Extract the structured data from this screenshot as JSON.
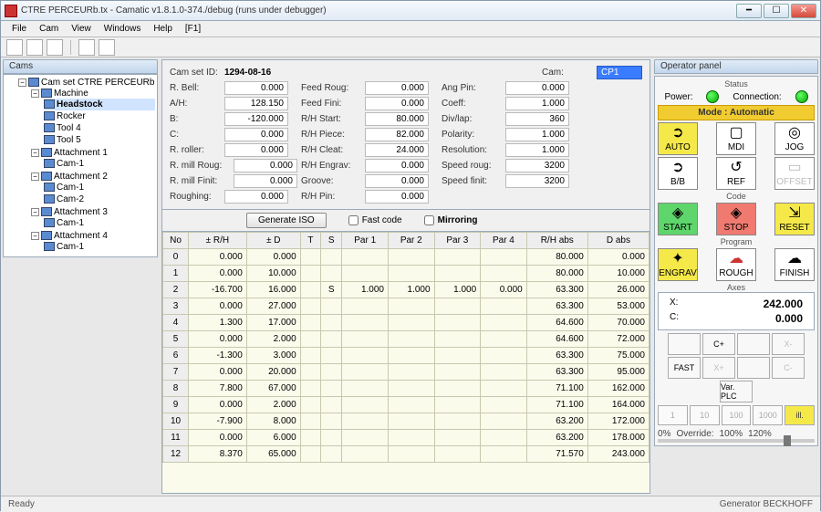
{
  "window": {
    "title": "CTRE PERCEURb.tx - Camatic v1.8.1.0-374./debug (runs under debugger)",
    "ghost1": "",
    "ghost2": "",
    "ghost3": ""
  },
  "menu": {
    "file": "File",
    "cam": "Cam",
    "view": "View",
    "windows": "Windows",
    "help": "Help",
    "f1": "[F1]"
  },
  "left_header": "Cams",
  "tree": {
    "root": "Cam set CTRE PERCEURb",
    "machine": "Machine",
    "headstock": "Headstock",
    "rocker": "Rocker",
    "tool4": "Tool 4",
    "tool5": "Tool 5",
    "att1": "Attachment 1",
    "a1c1": "Cam-1",
    "att2": "Attachment 2",
    "a2c1": "Cam-1",
    "a2c2": "Cam-2",
    "att3": "Attachment 3",
    "a3c1": "Cam-1",
    "att4": "Attachment 4",
    "a4c1": "Cam-1"
  },
  "form": {
    "camset_l": "Cam set ID:",
    "camset_v": "1294-08-16",
    "cam_l": "Cam:",
    "cam_v": "CP1",
    "rbell_l": "R. Bell:",
    "rbell_v": "0.000",
    "feedroug_l": "Feed Roug:",
    "feedroug_v": "0.000",
    "angpin_l": "Ang Pin:",
    "angpin_v": "0.000",
    "ah_l": "A/H:",
    "ah_v": "128.150",
    "feedfini_l": "Feed Fini:",
    "feedfini_v": "0.000",
    "coeff_l": "Coeff:",
    "coeff_v": "1.000",
    "b_l": "B:",
    "b_v": "-120.000",
    "rhstart_l": "R/H Start:",
    "rhstart_v": "80.000",
    "divlap_l": "Div/lap:",
    "divlap_v": "360",
    "c_l": "C:",
    "c_v": "0.000",
    "rhpiece_l": "R/H Piece:",
    "rhpiece_v": "82.000",
    "polarity_l": "Polarity:",
    "polarity_v": "1.000",
    "rroller_l": "R. roller:",
    "rroller_v": "0.000",
    "rhcleat_l": "R/H Cleat:",
    "rhcleat_v": "24.000",
    "resolution_l": "Resolution:",
    "resolution_v": "1.000",
    "rmillroug_l": "R. mill Roug:",
    "rmillroug_v": "0.000",
    "rhengrav_l": "R/H Engrav:",
    "rhengrav_v": "0.000",
    "speedroug_l": "Speed roug:",
    "speedroug_v": "3200",
    "rmillfinit_l": "R. mill Finit:",
    "rmillfinit_v": "0.000",
    "groove_l": "Groove:",
    "groove_v": "0.000",
    "speedfinit_l": "Speed finit:",
    "speedfinit_v": "3200",
    "roughing_l": "Roughing:",
    "roughing_v": "0.000",
    "rhpin_l": "R/H Pin:",
    "rhpin_v": "0.000"
  },
  "gen": {
    "btn": "Generate ISO",
    "fast": "Fast code",
    "mirror": "Mirroring"
  },
  "th": {
    "no": "No",
    "zrh": "± R/H",
    "zd": "± D",
    "t": "T",
    "s": "S",
    "p1": "Par 1",
    "p2": "Par 2",
    "p3": "Par 3",
    "p4": "Par 4",
    "rhabs": "R/H abs",
    "dabs": "D abs"
  },
  "rows": [
    {
      "no": "0",
      "zrh": "0.000",
      "zd": "0.000",
      "t": "",
      "s": "",
      "p1": "",
      "p2": "",
      "p3": "",
      "p4": "",
      "rhabs": "80.000",
      "dabs": "0.000"
    },
    {
      "no": "1",
      "zrh": "0.000",
      "zd": "10.000",
      "t": "",
      "s": "",
      "p1": "",
      "p2": "",
      "p3": "",
      "p4": "",
      "rhabs": "80.000",
      "dabs": "10.000"
    },
    {
      "no": "2",
      "zrh": "-16.700",
      "zd": "16.000",
      "t": "",
      "s": "S",
      "p1": "1.000",
      "p2": "1.000",
      "p3": "1.000",
      "p4": "0.000",
      "rhabs": "63.300",
      "dabs": "26.000"
    },
    {
      "no": "3",
      "zrh": "0.000",
      "zd": "27.000",
      "t": "",
      "s": "",
      "p1": "",
      "p2": "",
      "p3": "",
      "p4": "",
      "rhabs": "63.300",
      "dabs": "53.000"
    },
    {
      "no": "4",
      "zrh": "1.300",
      "zd": "17.000",
      "t": "",
      "s": "",
      "p1": "",
      "p2": "",
      "p3": "",
      "p4": "",
      "rhabs": "64.600",
      "dabs": "70.000"
    },
    {
      "no": "5",
      "zrh": "0.000",
      "zd": "2.000",
      "t": "",
      "s": "",
      "p1": "",
      "p2": "",
      "p3": "",
      "p4": "",
      "rhabs": "64.600",
      "dabs": "72.000"
    },
    {
      "no": "6",
      "zrh": "-1.300",
      "zd": "3.000",
      "t": "",
      "s": "",
      "p1": "",
      "p2": "",
      "p3": "",
      "p4": "",
      "rhabs": "63.300",
      "dabs": "75.000"
    },
    {
      "no": "7",
      "zrh": "0.000",
      "zd": "20.000",
      "t": "",
      "s": "",
      "p1": "",
      "p2": "",
      "p3": "",
      "p4": "",
      "rhabs": "63.300",
      "dabs": "95.000"
    },
    {
      "no": "8",
      "zrh": "7.800",
      "zd": "67.000",
      "t": "",
      "s": "",
      "p1": "",
      "p2": "",
      "p3": "",
      "p4": "",
      "rhabs": "71.100",
      "dabs": "162.000"
    },
    {
      "no": "9",
      "zrh": "0.000",
      "zd": "2.000",
      "t": "",
      "s": "",
      "p1": "",
      "p2": "",
      "p3": "",
      "p4": "",
      "rhabs": "71.100",
      "dabs": "164.000"
    },
    {
      "no": "10",
      "zrh": "-7.900",
      "zd": "8.000",
      "t": "",
      "s": "",
      "p1": "",
      "p2": "",
      "p3": "",
      "p4": "",
      "rhabs": "63.200",
      "dabs": "172.000"
    },
    {
      "no": "11",
      "zrh": "0.000",
      "zd": "6.000",
      "t": "",
      "s": "",
      "p1": "",
      "p2": "",
      "p3": "",
      "p4": "",
      "rhabs": "63.200",
      "dabs": "178.000"
    },
    {
      "no": "12",
      "zrh": "8.370",
      "zd": "65.000",
      "t": "",
      "s": "",
      "p1": "",
      "p2": "",
      "p3": "",
      "p4": "",
      "rhabs": "71.570",
      "dabs": "243.000"
    }
  ],
  "op": {
    "header": "Operator panel",
    "status": "Status",
    "power": "Power:",
    "connection": "Connection:",
    "mode": "Mode : Automatic",
    "auto": "AUTO",
    "mdi": "MDI",
    "jog": "JOG",
    "bb": "B/B",
    "ref": "REF",
    "offset": "OFFSET",
    "code": "Code",
    "start": "START",
    "stop": "STOP",
    "reset": "RESET",
    "program": "Program",
    "engrav": "ENGRAV",
    "rough": "ROUGH",
    "finish": "FINISH",
    "axes": "Axes",
    "x_l": "X:",
    "x_v": "242.000",
    "c_l": "C:",
    "c_v": "0.000",
    "cp": "C+",
    "xm": "X-",
    "fast": "FAST",
    "xp": "X+",
    "cm": "C-",
    "varplc": "Var. PLC",
    "n1": "1",
    "n10": "10",
    "n100": "100",
    "n1000": "1000",
    "nill": "ill.",
    "ov0": "0%",
    "ovlbl": "Override:",
    "ov100": "100%",
    "ov120": "120%"
  },
  "status": {
    "ready": "Ready",
    "gen": "Generator BECKHOFF"
  }
}
